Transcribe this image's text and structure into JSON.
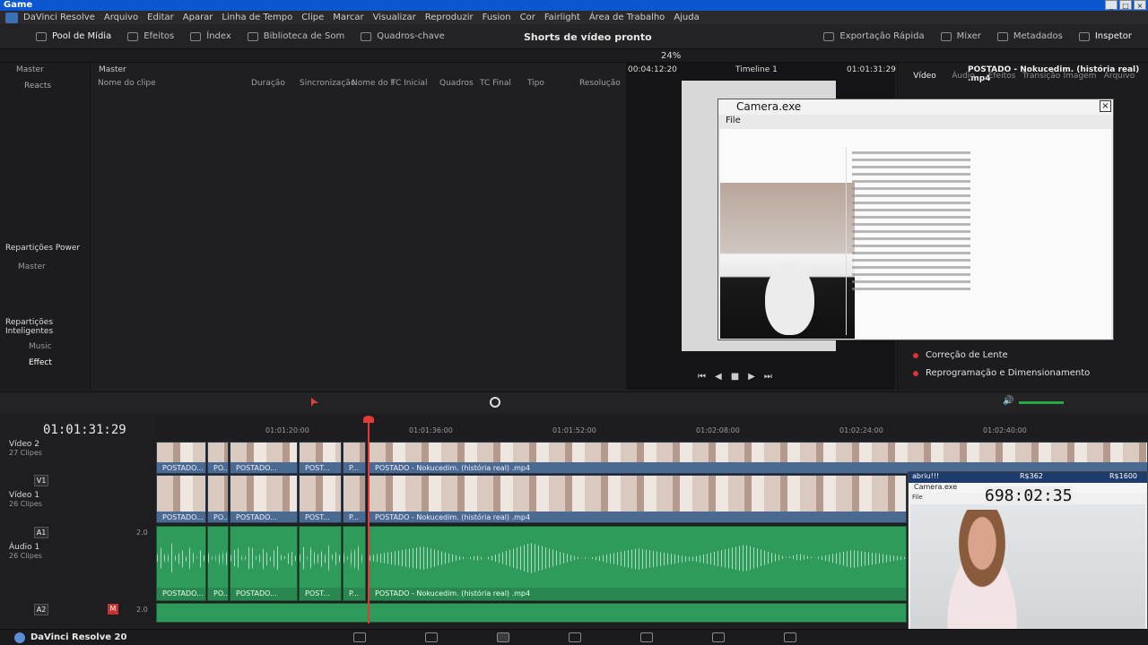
{
  "window": {
    "title": "Game"
  },
  "menu": [
    "DaVinci Resolve",
    "Arquivo",
    "Editar",
    "Aparar",
    "Linha de Tempo",
    "Clipe",
    "Marcar",
    "Visualizar",
    "Reproduzir",
    "Fusion",
    "Cor",
    "Fairlight",
    "Área de Trabalho",
    "Ajuda"
  ],
  "toolbar": {
    "pool": "Pool de Mídia",
    "effects": "Efeitos",
    "index": "Índex",
    "sound_lib": "Biblioteca de Som",
    "keyframes": "Quadros-chave",
    "project_title": "Shorts de vídeo pronto",
    "quick_export": "Exportação Rápida",
    "mixer": "Mixer",
    "metadata": "Metadados",
    "inspector": "Inspetor"
  },
  "viewer": {
    "zoom": "24%",
    "src_tc": "00:04:12:20",
    "timeline_name": "Timeline 1",
    "tc": "01:01:31:29",
    "clip_name": "POSTADO - Nokucedim. (história real) .mp4"
  },
  "left_panel": {
    "master": "Master",
    "reacts": "Reacts",
    "power_bins": "Repartições Power",
    "power_master": "Master",
    "smart_bins": "Repartições Inteligentes",
    "music": "Music",
    "effect": "Effect"
  },
  "clip_list": {
    "bin": "Master",
    "columns": [
      "Nome do clipe",
      "Duração",
      "Sincronização",
      "Nome do F",
      "TC Inicial",
      "Quadros",
      "TC Final",
      "Tipo",
      "Resolução"
    ]
  },
  "inspector": {
    "tabs": [
      "Vídeo",
      "Áudio",
      "Efeitos",
      "Transição",
      "Imagem",
      "Arquivo"
    ],
    "rows": [
      "Correção de Lente",
      "Reprogramação e Dimensionamento"
    ]
  },
  "camera_window": {
    "title": "Camera.exe",
    "menu": "File"
  },
  "timeline": {
    "timecode": "01:01:31:29",
    "ruler": [
      "01:01:20:00",
      "01:01:36:00",
      "01:01:52:00",
      "01:02:08:00",
      "01:02:24:00",
      "01:02:40:00"
    ],
    "tracks": [
      {
        "id": "V2",
        "name": "Vídeo 2",
        "clips": "27 Clipes"
      },
      {
        "id": "V1",
        "name": "Vídeo 1",
        "clips": "26 Clipes"
      },
      {
        "id": "A1",
        "name": "Áudio 1",
        "clips": "26 Clipes",
        "level": "2.0"
      },
      {
        "id": "A2",
        "name": "",
        "clips": "",
        "level": "2.0"
      }
    ],
    "clip_labels": {
      "short1": "POSTADO...",
      "short2": "PO...",
      "short3": "POSTADO...",
      "short4": "POST...",
      "short5": "P...",
      "long": "POSTADO - Nokucedim. (história real) .mp4"
    }
  },
  "webcam": {
    "timer": "698:02:35",
    "user": "abriu!!!",
    "amount1": "R$362",
    "amount2": "R$1600",
    "title": "Camera.exe",
    "menu": "File"
  },
  "status": {
    "app": "DaVinci Resolve 20"
  },
  "colors": {
    "accent": "#0b57d0",
    "video_clip": "#6f8fb4",
    "audio_clip": "#2f9b5b",
    "playhead": "#e03a3a"
  }
}
